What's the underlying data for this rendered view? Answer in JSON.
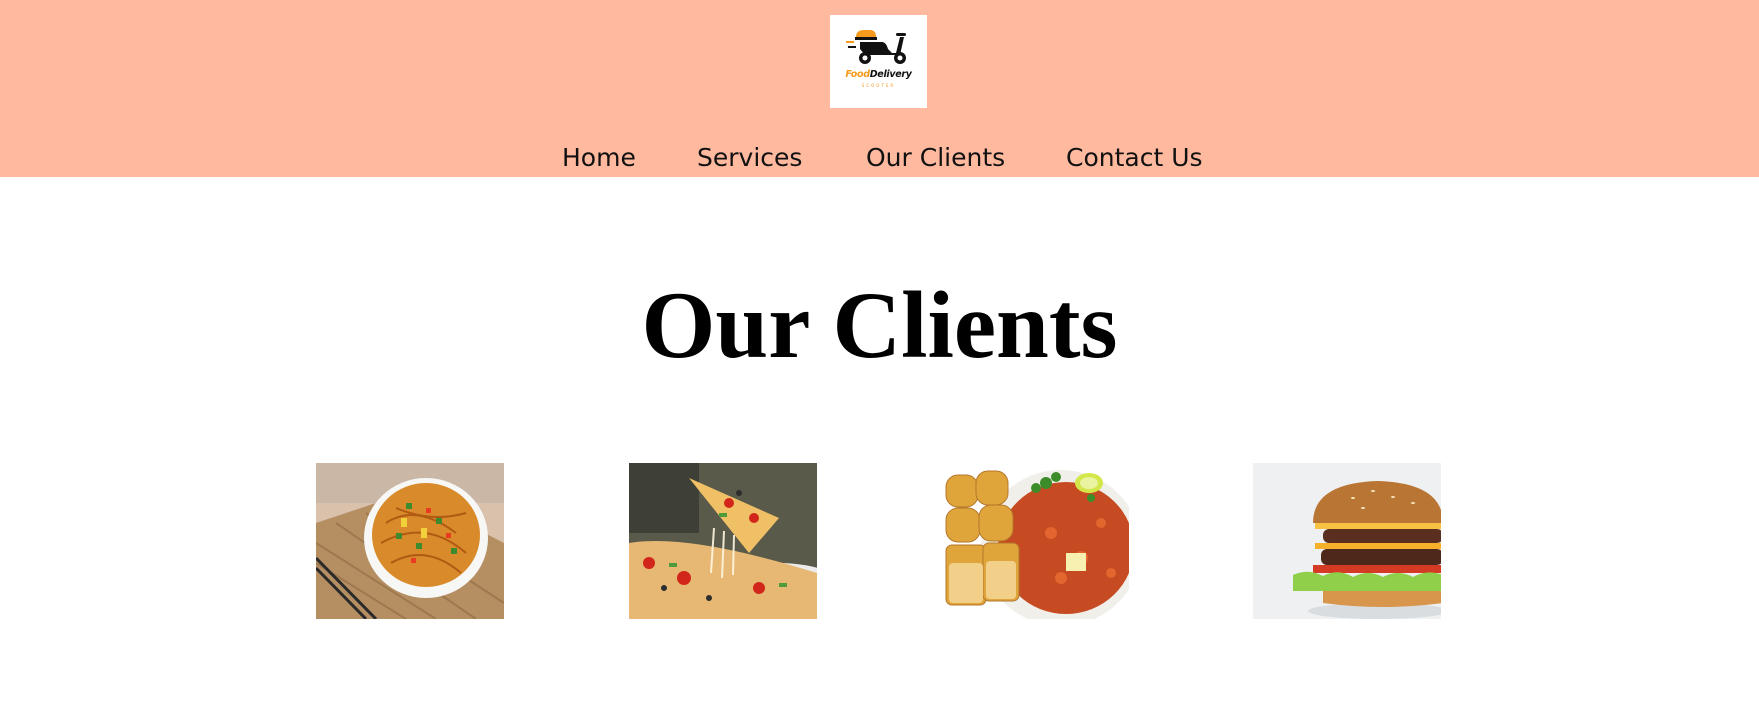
{
  "header": {
    "background": "#ffb99e",
    "logo": {
      "icon": "scooter-delivery-icon",
      "text_food": "Food",
      "text_delivery": "Delivery",
      "tagline": "SCOOTER",
      "accent": "#f59a1c"
    },
    "nav": [
      {
        "label": "Home"
      },
      {
        "label": "Services"
      },
      {
        "label": "Our Clients"
      },
      {
        "label": "Contact Us"
      }
    ]
  },
  "main": {
    "title": "Our Clients",
    "clients": [
      {
        "image": "noodles-bowl-image"
      },
      {
        "image": "pizza-slice-image"
      },
      {
        "image": "pav-bhaji-image"
      },
      {
        "image": "burger-image"
      }
    ]
  }
}
